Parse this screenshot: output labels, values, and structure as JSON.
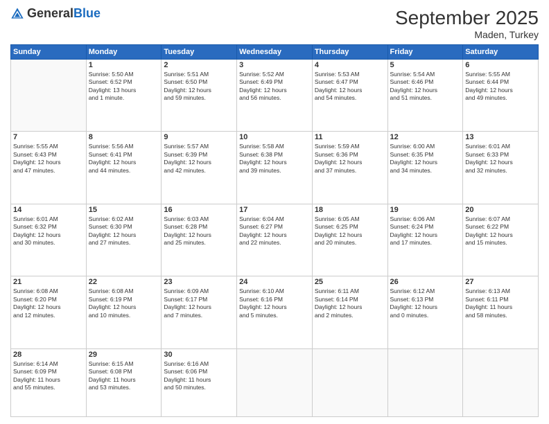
{
  "logo": {
    "general": "General",
    "blue": "Blue"
  },
  "header": {
    "month": "September 2025",
    "location": "Maden, Turkey"
  },
  "days_of_week": [
    "Sunday",
    "Monday",
    "Tuesday",
    "Wednesday",
    "Thursday",
    "Friday",
    "Saturday"
  ],
  "weeks": [
    [
      {
        "day": "",
        "info": ""
      },
      {
        "day": "1",
        "info": "Sunrise: 5:50 AM\nSunset: 6:52 PM\nDaylight: 13 hours\nand 1 minute."
      },
      {
        "day": "2",
        "info": "Sunrise: 5:51 AM\nSunset: 6:50 PM\nDaylight: 12 hours\nand 59 minutes."
      },
      {
        "day": "3",
        "info": "Sunrise: 5:52 AM\nSunset: 6:49 PM\nDaylight: 12 hours\nand 56 minutes."
      },
      {
        "day": "4",
        "info": "Sunrise: 5:53 AM\nSunset: 6:47 PM\nDaylight: 12 hours\nand 54 minutes."
      },
      {
        "day": "5",
        "info": "Sunrise: 5:54 AM\nSunset: 6:46 PM\nDaylight: 12 hours\nand 51 minutes."
      },
      {
        "day": "6",
        "info": "Sunrise: 5:55 AM\nSunset: 6:44 PM\nDaylight: 12 hours\nand 49 minutes."
      }
    ],
    [
      {
        "day": "7",
        "info": "Sunrise: 5:55 AM\nSunset: 6:43 PM\nDaylight: 12 hours\nand 47 minutes."
      },
      {
        "day": "8",
        "info": "Sunrise: 5:56 AM\nSunset: 6:41 PM\nDaylight: 12 hours\nand 44 minutes."
      },
      {
        "day": "9",
        "info": "Sunrise: 5:57 AM\nSunset: 6:39 PM\nDaylight: 12 hours\nand 42 minutes."
      },
      {
        "day": "10",
        "info": "Sunrise: 5:58 AM\nSunset: 6:38 PM\nDaylight: 12 hours\nand 39 minutes."
      },
      {
        "day": "11",
        "info": "Sunrise: 5:59 AM\nSunset: 6:36 PM\nDaylight: 12 hours\nand 37 minutes."
      },
      {
        "day": "12",
        "info": "Sunrise: 6:00 AM\nSunset: 6:35 PM\nDaylight: 12 hours\nand 34 minutes."
      },
      {
        "day": "13",
        "info": "Sunrise: 6:01 AM\nSunset: 6:33 PM\nDaylight: 12 hours\nand 32 minutes."
      }
    ],
    [
      {
        "day": "14",
        "info": "Sunrise: 6:01 AM\nSunset: 6:32 PM\nDaylight: 12 hours\nand 30 minutes."
      },
      {
        "day": "15",
        "info": "Sunrise: 6:02 AM\nSunset: 6:30 PM\nDaylight: 12 hours\nand 27 minutes."
      },
      {
        "day": "16",
        "info": "Sunrise: 6:03 AM\nSunset: 6:28 PM\nDaylight: 12 hours\nand 25 minutes."
      },
      {
        "day": "17",
        "info": "Sunrise: 6:04 AM\nSunset: 6:27 PM\nDaylight: 12 hours\nand 22 minutes."
      },
      {
        "day": "18",
        "info": "Sunrise: 6:05 AM\nSunset: 6:25 PM\nDaylight: 12 hours\nand 20 minutes."
      },
      {
        "day": "19",
        "info": "Sunrise: 6:06 AM\nSunset: 6:24 PM\nDaylight: 12 hours\nand 17 minutes."
      },
      {
        "day": "20",
        "info": "Sunrise: 6:07 AM\nSunset: 6:22 PM\nDaylight: 12 hours\nand 15 minutes."
      }
    ],
    [
      {
        "day": "21",
        "info": "Sunrise: 6:08 AM\nSunset: 6:20 PM\nDaylight: 12 hours\nand 12 minutes."
      },
      {
        "day": "22",
        "info": "Sunrise: 6:08 AM\nSunset: 6:19 PM\nDaylight: 12 hours\nand 10 minutes."
      },
      {
        "day": "23",
        "info": "Sunrise: 6:09 AM\nSunset: 6:17 PM\nDaylight: 12 hours\nand 7 minutes."
      },
      {
        "day": "24",
        "info": "Sunrise: 6:10 AM\nSunset: 6:16 PM\nDaylight: 12 hours\nand 5 minutes."
      },
      {
        "day": "25",
        "info": "Sunrise: 6:11 AM\nSunset: 6:14 PM\nDaylight: 12 hours\nand 2 minutes."
      },
      {
        "day": "26",
        "info": "Sunrise: 6:12 AM\nSunset: 6:13 PM\nDaylight: 12 hours\nand 0 minutes."
      },
      {
        "day": "27",
        "info": "Sunrise: 6:13 AM\nSunset: 6:11 PM\nDaylight: 11 hours\nand 58 minutes."
      }
    ],
    [
      {
        "day": "28",
        "info": "Sunrise: 6:14 AM\nSunset: 6:09 PM\nDaylight: 11 hours\nand 55 minutes."
      },
      {
        "day": "29",
        "info": "Sunrise: 6:15 AM\nSunset: 6:08 PM\nDaylight: 11 hours\nand 53 minutes."
      },
      {
        "day": "30",
        "info": "Sunrise: 6:16 AM\nSunset: 6:06 PM\nDaylight: 11 hours\nand 50 minutes."
      },
      {
        "day": "",
        "info": ""
      },
      {
        "day": "",
        "info": ""
      },
      {
        "day": "",
        "info": ""
      },
      {
        "day": "",
        "info": ""
      }
    ]
  ]
}
